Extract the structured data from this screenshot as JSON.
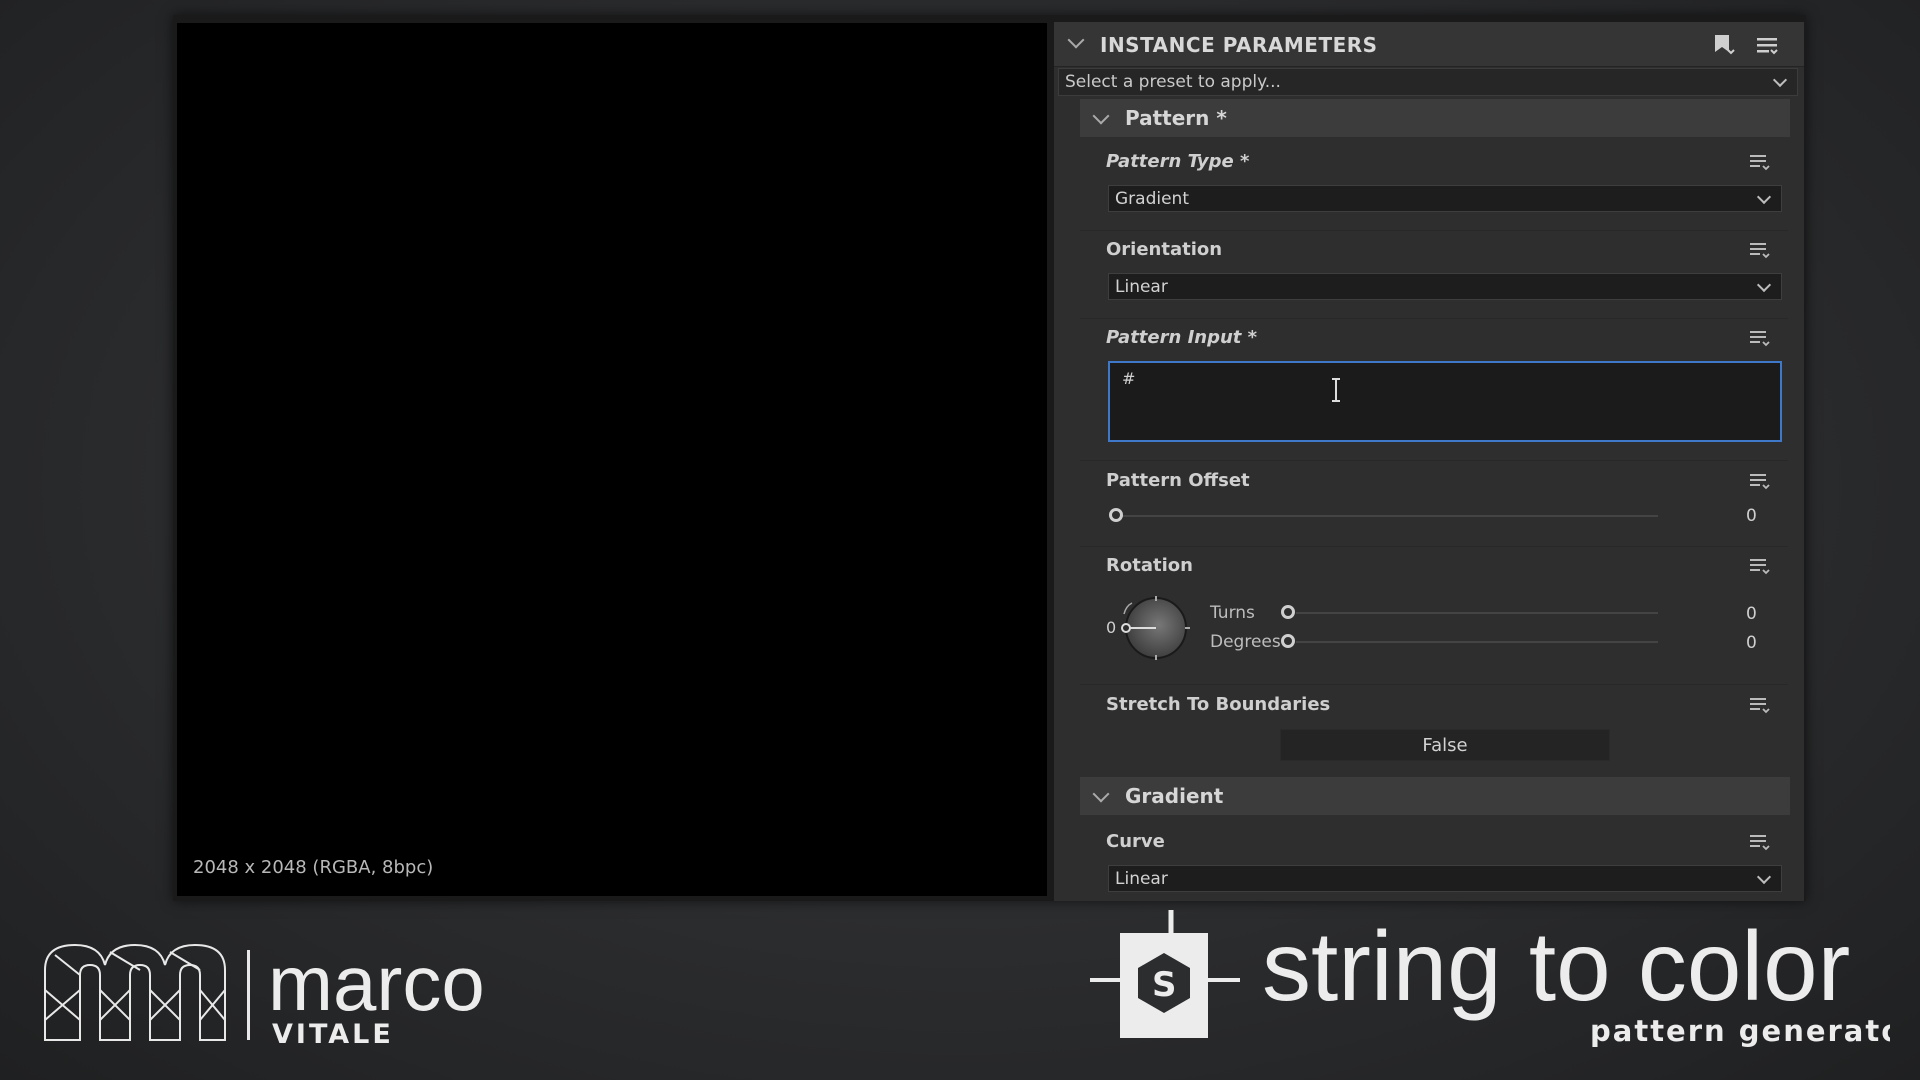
{
  "viewport": {
    "info": "2048 x 2048 (RGBA, 8bpc)"
  },
  "panel": {
    "title": "INSTANCE PARAMETERS",
    "preset_placeholder": "Select a preset to apply..."
  },
  "sections": {
    "pattern": "Pattern *",
    "gradient": "Gradient"
  },
  "params": {
    "pattern_type": {
      "label": "Pattern Type *",
      "value": "Gradient"
    },
    "orientation": {
      "label": "Orientation",
      "value": "Linear"
    },
    "pattern_input": {
      "label": "Pattern Input *",
      "value": "#"
    },
    "pattern_offset": {
      "label": "Pattern Offset",
      "value": "0"
    },
    "rotation": {
      "label": "Rotation",
      "dial_value": "0",
      "turns_label": "Turns",
      "turns_value": "0",
      "degrees_label": "Degrees",
      "degrees_value": "0"
    },
    "stretch": {
      "label": "Stretch To Boundaries",
      "value": "False"
    },
    "curve": {
      "label": "Curve",
      "value": "Linear"
    }
  },
  "branding": {
    "left_name": "marco",
    "left_sub": "VITALE",
    "right_title": "string to color",
    "right_sub": "pattern generator"
  },
  "icons": {
    "collapse": "chevron-down-icon",
    "preset": "bookmark-icon",
    "menu": "hamburger-menu-icon",
    "param_menu": "list-dropdown-icon",
    "cursor": "text-cursor-icon",
    "app_logo": "substance-s-icon"
  }
}
